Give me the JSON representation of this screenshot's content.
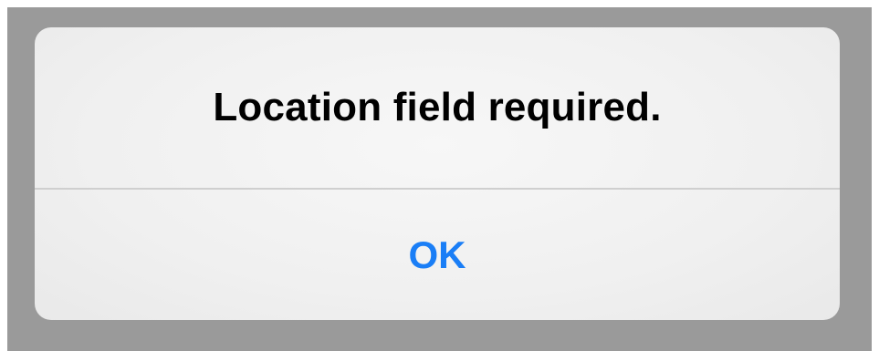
{
  "alert": {
    "message": "Location field required.",
    "button_label": "OK"
  },
  "colors": {
    "overlay": "#9a9a9a",
    "alert_background": "#f0f0f0",
    "message_text": "#000000",
    "button_text": "#1a7ef6",
    "divider": "#cfcfcf"
  }
}
